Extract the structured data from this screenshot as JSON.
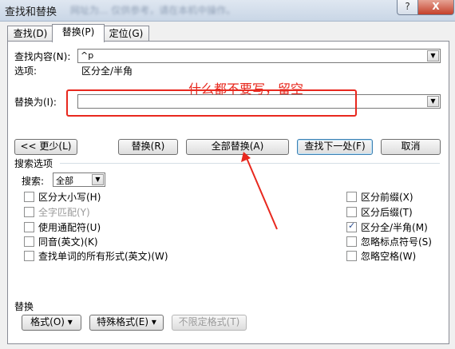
{
  "window": {
    "title": "查找和替换",
    "blurred_caption": "网址为... 仅供参考，请在本机中操作。",
    "help_label": "?",
    "close_label": "X"
  },
  "tabs": [
    {
      "label": "查找(D)"
    },
    {
      "label": "替换(P)"
    },
    {
      "label": "定位(G)"
    }
  ],
  "find": {
    "label": "查找内容(N):",
    "value": "^p",
    "options_label": "选项:",
    "options_value": "区分全/半角"
  },
  "replace": {
    "label": "替换为(I):",
    "value": ""
  },
  "annotation": {
    "text": "什么都不要写，留空",
    "color": "#e8281e"
  },
  "buttons": {
    "less": "<< 更少(L)",
    "replace": "替换(R)",
    "replace_all": "全部替换(A)",
    "find_next": "查找下一处(F)",
    "cancel": "取消"
  },
  "search_options": {
    "title": "搜索选项",
    "search_label": "搜索:",
    "search_value": "全部",
    "left": [
      {
        "label": "区分大小写(H)",
        "checked": false,
        "disabled": false
      },
      {
        "label": "全字匹配(Y)",
        "checked": false,
        "disabled": true
      },
      {
        "label": "使用通配符(U)",
        "checked": false,
        "disabled": false
      },
      {
        "label": "同音(英文)(K)",
        "checked": false,
        "disabled": false
      },
      {
        "label": "查找单词的所有形式(英文)(W)",
        "checked": false,
        "disabled": false
      }
    ],
    "right": [
      {
        "label": "区分前缀(X)",
        "checked": false,
        "disabled": false
      },
      {
        "label": "区分后缀(T)",
        "checked": false,
        "disabled": false
      },
      {
        "label": "区分全/半角(M)",
        "checked": true,
        "disabled": false
      },
      {
        "label": "忽略标点符号(S)",
        "checked": false,
        "disabled": false
      },
      {
        "label": "忽略空格(W)",
        "checked": false,
        "disabled": false
      }
    ]
  },
  "replace_section": {
    "title": "替换",
    "format": "格式(O) ▾",
    "special": "特殊格式(E) ▾",
    "no_format": "不限定格式(T)"
  }
}
